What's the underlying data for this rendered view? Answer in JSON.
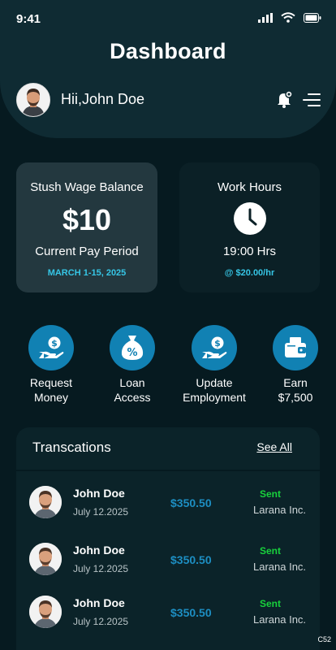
{
  "status_bar": {
    "time": "9:41"
  },
  "header": {
    "title": "Dashboard",
    "greeting": "Hii,John Doe"
  },
  "cards": {
    "balance": {
      "title": "Stush Wage Balance",
      "amount": "$10",
      "period_label": "Current Pay Period",
      "period_dates": "MARCH 1-15, 2025"
    },
    "hours": {
      "title": "Work Hours",
      "hours": "19:00 Hrs",
      "rate": "@ $20.00/hr"
    }
  },
  "actions": [
    {
      "line1": "Request",
      "line2": "Money",
      "icon": "hand-coin-icon"
    },
    {
      "line1": "Loan",
      "line2": "Access",
      "icon": "money-bag-percent-icon"
    },
    {
      "line1": "Update",
      "line2": "Employment",
      "icon": "hand-coin-icon"
    },
    {
      "line1": "Earn",
      "line2": "$7,500",
      "icon": "wallet-icon"
    }
  ],
  "transactions": {
    "title": "Transcations",
    "see_all": "See All",
    "items": [
      {
        "name": "John Doe",
        "date": "July 12.2025",
        "amount": "$350.50",
        "status": "Sent",
        "company": "Larana Inc."
      },
      {
        "name": "John Doe",
        "date": "July 12.2025",
        "amount": "$350.50",
        "status": "Sent",
        "company": "Larana Inc."
      },
      {
        "name": "John Doe",
        "date": "July 12.2025",
        "amount": "$350.50",
        "status": "Sent",
        "company": "Larana Inc."
      }
    ]
  },
  "corner_label": "C52",
  "colors": {
    "accent": "#1181b3",
    "highlight": "#36c6e6",
    "sent": "#18d23c",
    "background": "#061a20"
  }
}
